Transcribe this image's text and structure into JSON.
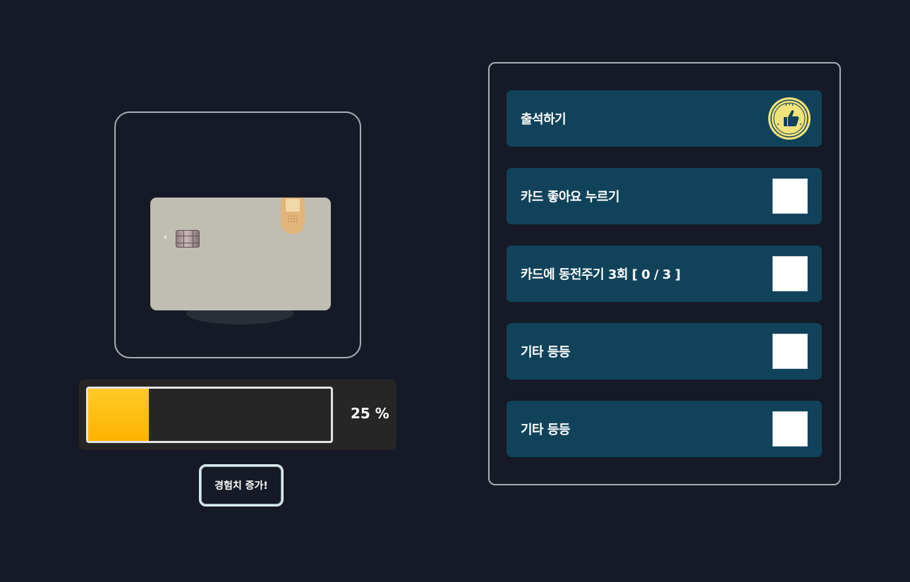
{
  "progress": {
    "percent": 25,
    "text": "25 %"
  },
  "exp_button": {
    "label": "경험치 증가!"
  },
  "tasks": [
    {
      "label": "출석하기",
      "done": true,
      "icon": "thumbs-up-stamp-icon"
    },
    {
      "label": "카드 좋아요 누르기",
      "done": false
    },
    {
      "label": "카드에 동전주기 3회 [ 0 / 3 ]",
      "done": false
    },
    {
      "label": "기타 등등",
      "done": false
    },
    {
      "label": "기타 등등",
      "done": false
    }
  ],
  "colors": {
    "background": "#151a26",
    "task_bg": "#10435a",
    "progress_fill": "#ffc107",
    "card": "#c0bdb2"
  }
}
